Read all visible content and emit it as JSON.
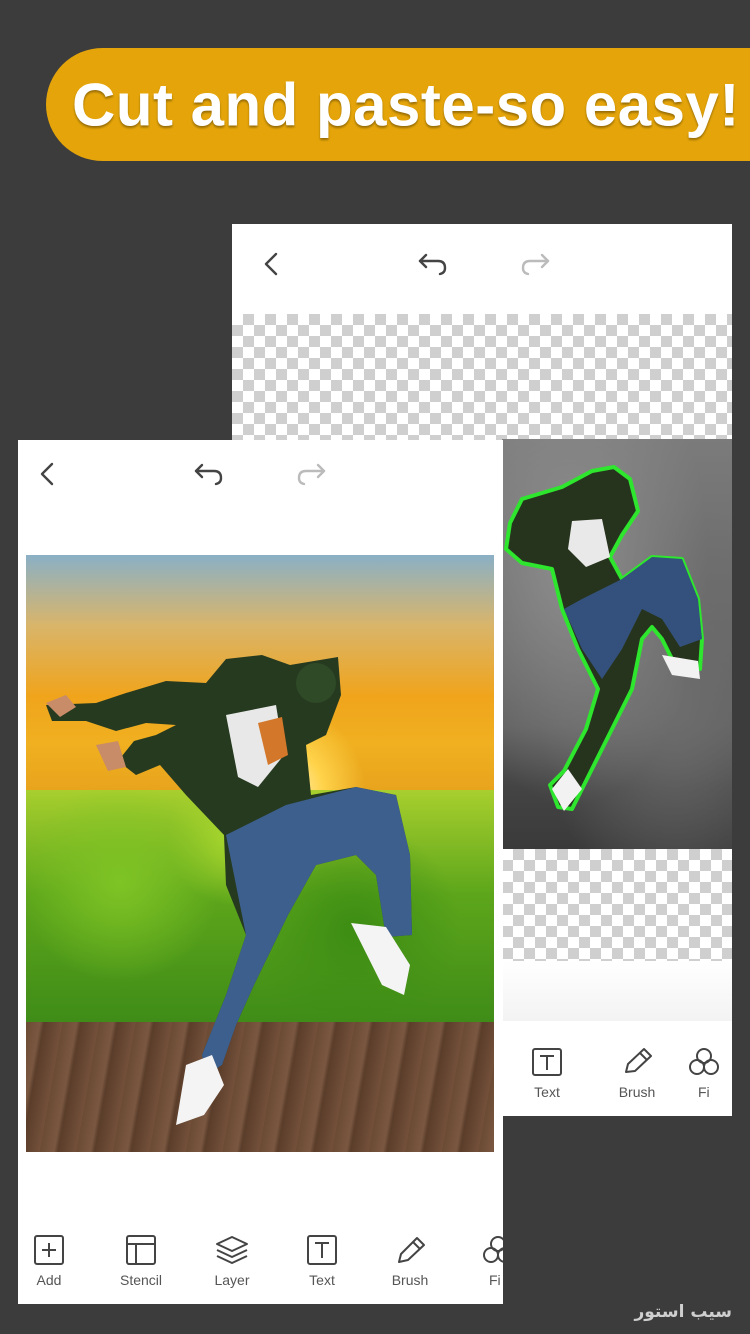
{
  "banner": {
    "title": "Cut and paste-so easy!"
  },
  "back_screen": {
    "toolbar": [
      {
        "label": "Text",
        "icon": "text-icon"
      },
      {
        "label": "Brush",
        "icon": "brush-icon"
      },
      {
        "label": "Fi",
        "icon": "filter-icon"
      }
    ]
  },
  "front_screen": {
    "toolbar": [
      {
        "label": "Add",
        "icon": "add-icon"
      },
      {
        "label": "Stencil",
        "icon": "stencil-icon"
      },
      {
        "label": "Layer",
        "icon": "layer-icon"
      },
      {
        "label": "Text",
        "icon": "text-icon"
      },
      {
        "label": "Brush",
        "icon": "brush-icon"
      },
      {
        "label": "Fi",
        "icon": "filter-icon"
      }
    ]
  },
  "watermark": {
    "text": "سیب استور"
  },
  "colors": {
    "background": "#3c3c3c",
    "banner": "#e5a50a",
    "outline": "#2ee62e"
  }
}
